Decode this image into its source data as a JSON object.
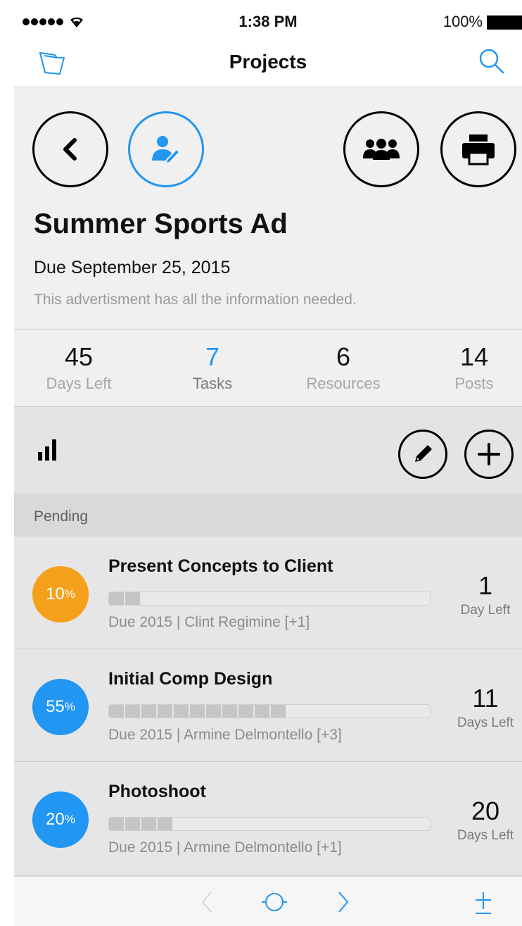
{
  "status_bar": {
    "time": "1:38 PM",
    "battery": "100%"
  },
  "nav": {
    "title": "Projects",
    "left_icon": "folder-icon",
    "right_icon": "search-icon"
  },
  "project": {
    "title": "Summer Sports Ad",
    "due": "Due September 25, 2015",
    "description": "This advertisment has all the information needed.",
    "header_buttons": [
      "back-icon",
      "user-edit-icon",
      "team-icon",
      "print-icon"
    ]
  },
  "stats": [
    {
      "value": "45",
      "label": "Days Left"
    },
    {
      "value": "7",
      "label": "Tasks"
    },
    {
      "value": "6",
      "label": "Resources"
    },
    {
      "value": "14",
      "label": "Posts"
    }
  ],
  "toolbar": {
    "left_icon": "bar-chart-icon",
    "edit_icon": "pencil-icon",
    "add_icon": "plus-icon"
  },
  "section": {
    "label": "Pending"
  },
  "tasks": [
    {
      "percent": "10",
      "percent_sign": "%",
      "progress_value": 0.1,
      "title": "Present Concepts to Client",
      "meta": "Due 2015 | Clint Regimine [+1]",
      "days": "1",
      "days_label": "Day Left",
      "color": "#f5a01a"
    },
    {
      "percent": "55",
      "percent_sign": "%",
      "progress_value": 0.55,
      "title": "Initial Comp Design",
      "meta": "Due 2015 | Armine Delmontello [+3]",
      "days": "11",
      "days_label": "Days Left",
      "color": "#2196f3"
    },
    {
      "percent": "20",
      "percent_sign": "%",
      "progress_value": 0.2,
      "title": "Photoshoot",
      "meta": "Due 2015 | Armine Delmontello [+1]",
      "days": "20",
      "days_label": "Days Left",
      "color": "#2196f3"
    }
  ],
  "colors": {
    "accent": "#2196f3",
    "orange": "#f5a01a"
  }
}
